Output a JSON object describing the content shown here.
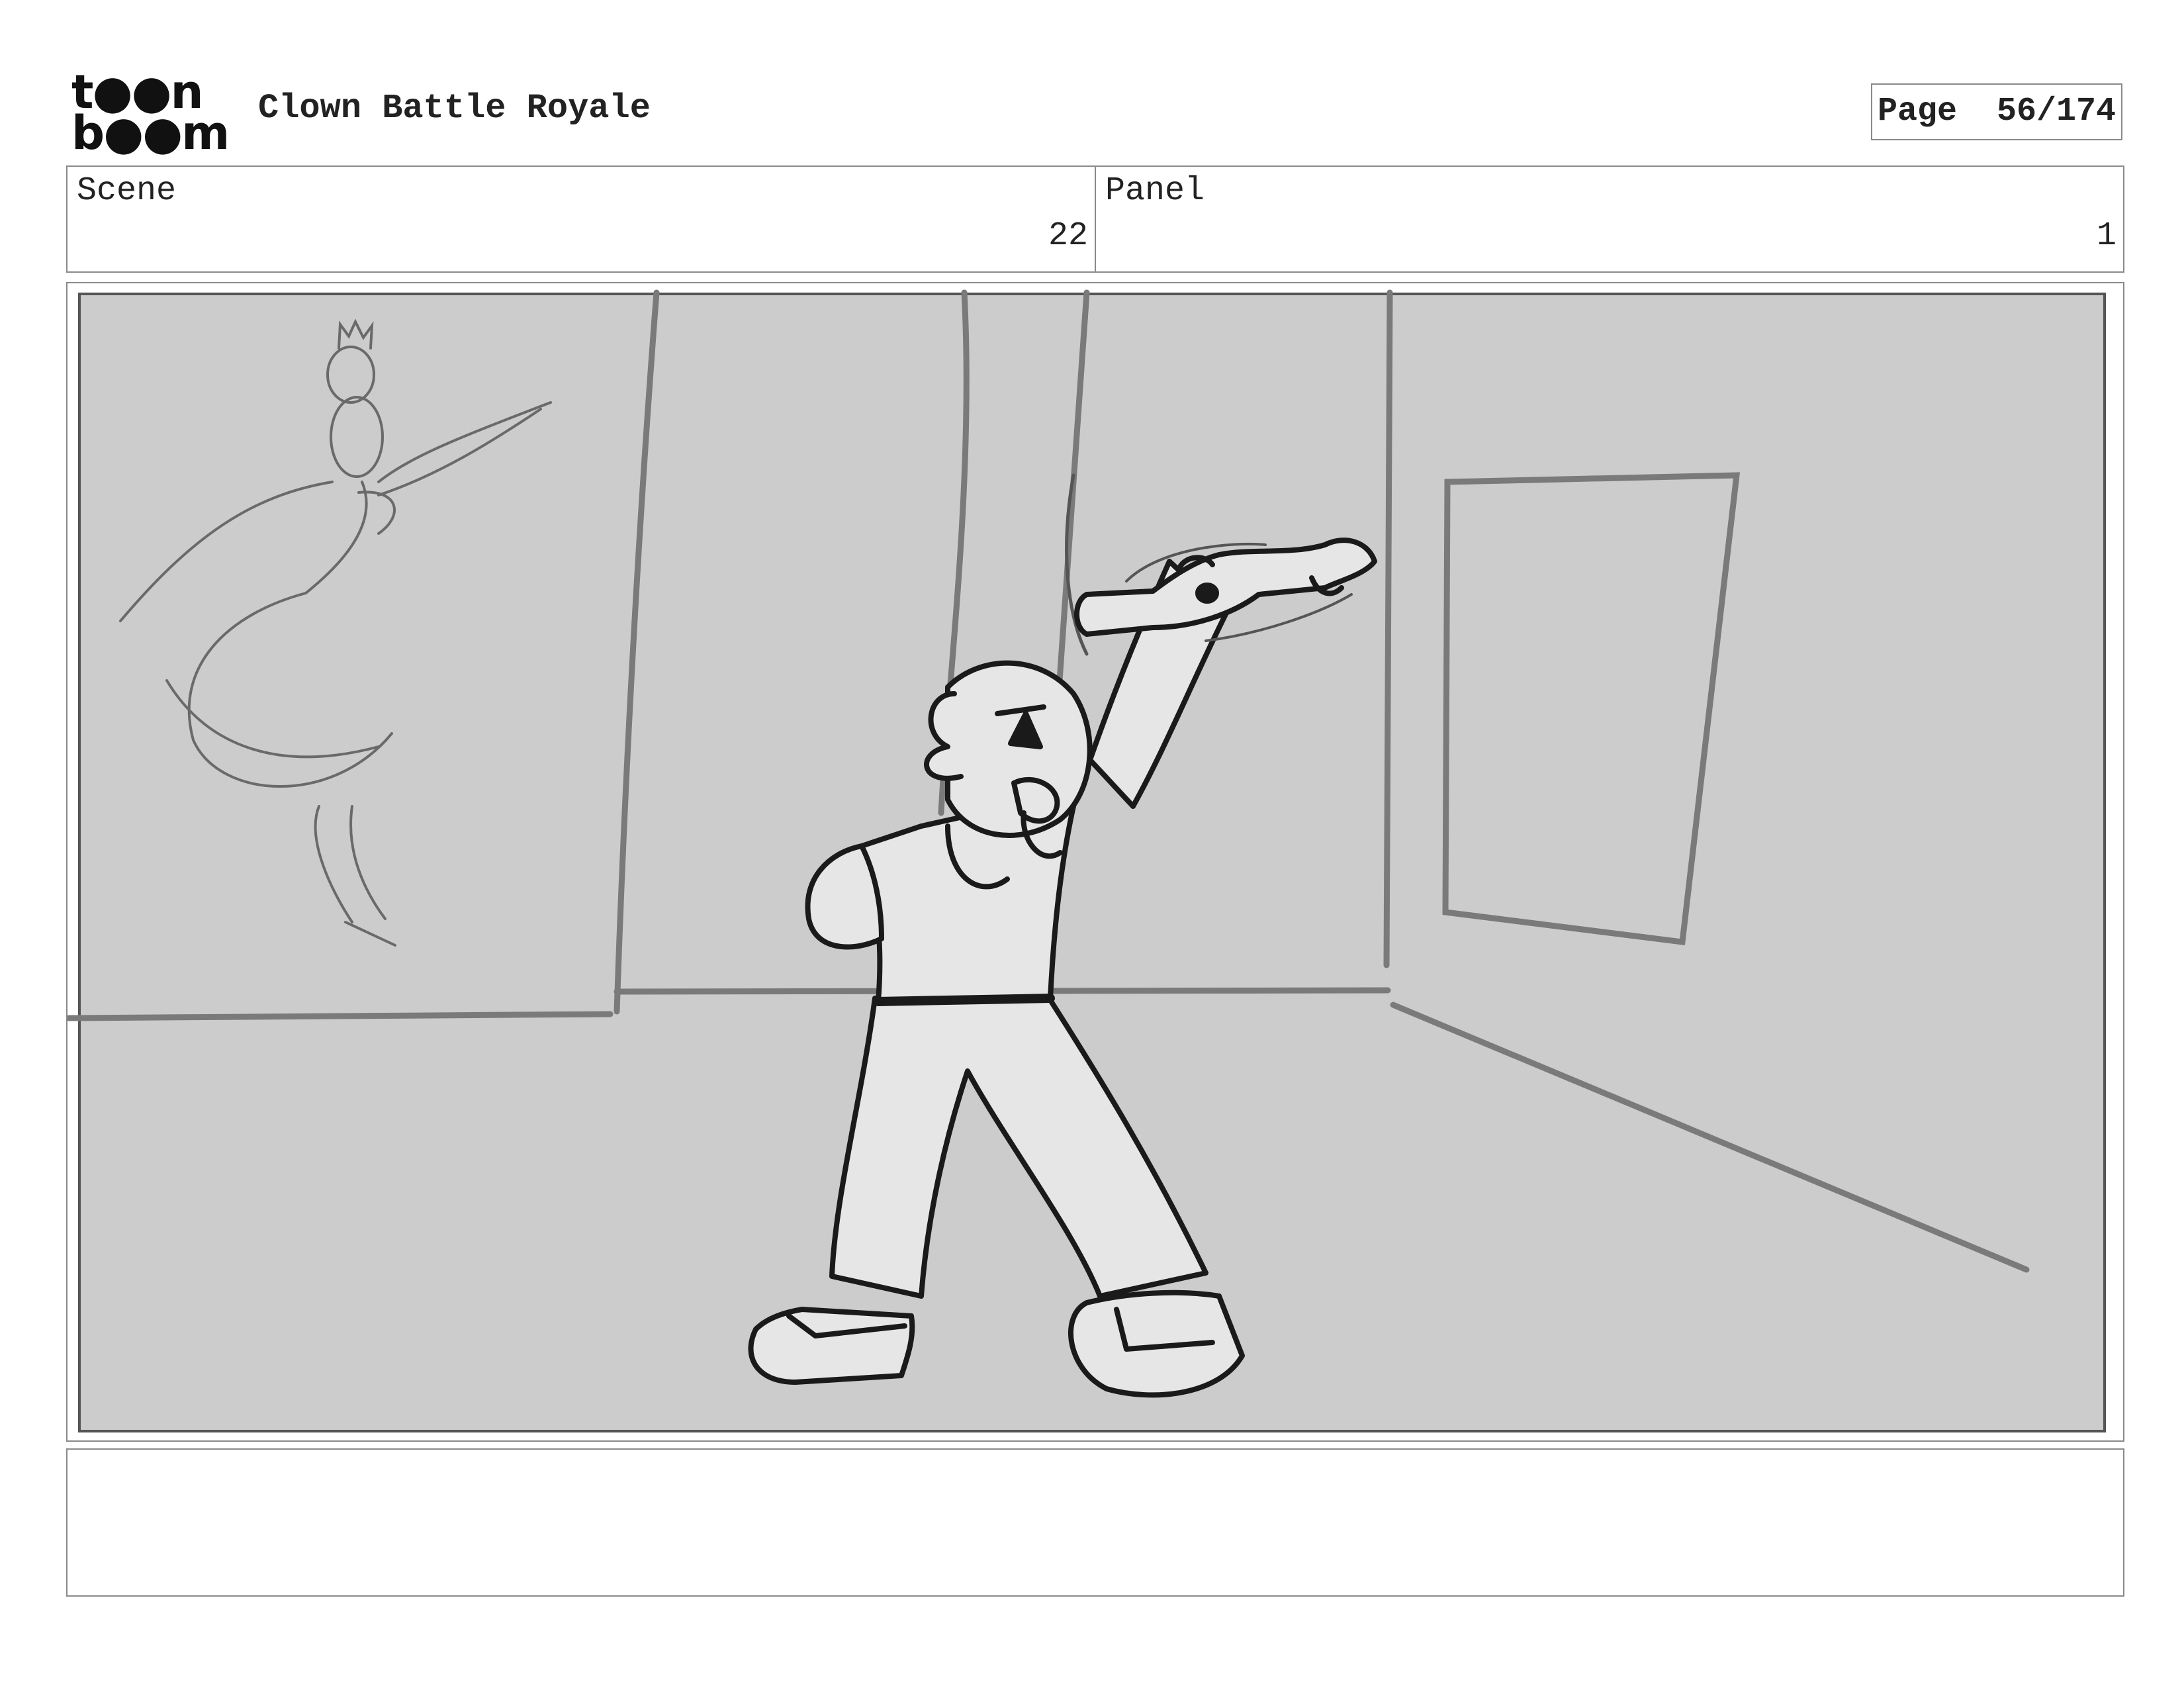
{
  "header": {
    "logo": {
      "line1": "t●●n",
      "line2": "b●●m"
    },
    "title": "Clown Battle Royale",
    "page_label": "Page",
    "page_number": "56/174"
  },
  "info": {
    "scene_label": "Scene",
    "scene_value": "22",
    "panel_label": "Panel",
    "panel_value": "1"
  },
  "colors": {
    "panel_background": "#cccccc",
    "figure_fill": "#e6e6e6",
    "ink": "#1a1a1a",
    "sketch_line": "#7a7a7a",
    "border": "#8a8a8a"
  },
  "caption": {
    "text": ""
  }
}
